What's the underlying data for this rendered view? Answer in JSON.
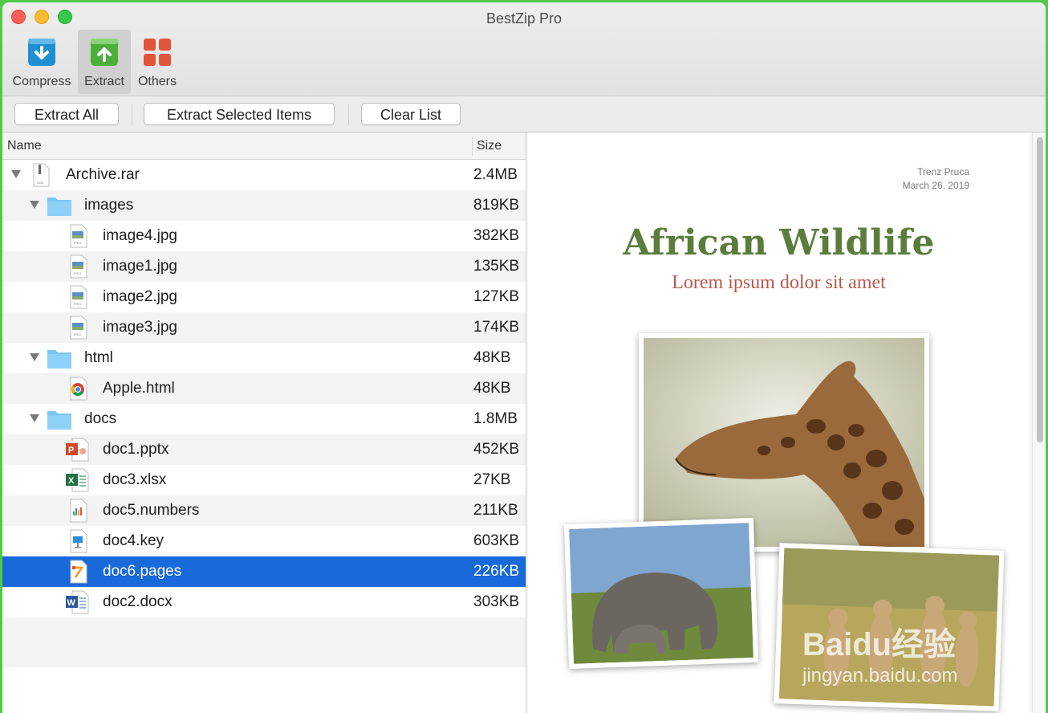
{
  "window": {
    "title": "BestZip Pro"
  },
  "toolbar": {
    "compress_label": "Compress",
    "extract_label": "Extract",
    "others_label": "Others"
  },
  "actions": {
    "extract_all": "Extract All",
    "extract_selected": "Extract Selected Items",
    "clear_list": "Clear List"
  },
  "list": {
    "columns": {
      "name": "Name",
      "size": "Size"
    },
    "rows": [
      {
        "name": "Archive.rar",
        "size": "2.4MB",
        "icon": "archive-icon"
      },
      {
        "name": "images",
        "size": "819KB",
        "icon": "folder-icon"
      },
      {
        "name": "image4.jpg",
        "size": "382KB",
        "icon": "jpeg-icon"
      },
      {
        "name": "image1.jpg",
        "size": "135KB",
        "icon": "jpeg-icon"
      },
      {
        "name": "image2.jpg",
        "size": "127KB",
        "icon": "jpeg-icon"
      },
      {
        "name": "image3.jpg",
        "size": "174KB",
        "icon": "jpeg-icon"
      },
      {
        "name": "html",
        "size": "48KB",
        "icon": "folder-icon"
      },
      {
        "name": "Apple.html",
        "size": "48KB",
        "icon": "chrome-icon"
      },
      {
        "name": "docs",
        "size": "1.8MB",
        "icon": "folder-icon"
      },
      {
        "name": "doc1.pptx",
        "size": "452KB",
        "icon": "powerpoint-icon"
      },
      {
        "name": "doc3.xlsx",
        "size": "27KB",
        "icon": "excel-icon"
      },
      {
        "name": "doc5.numbers",
        "size": "211KB",
        "icon": "numbers-icon"
      },
      {
        "name": "doc4.key",
        "size": "603KB",
        "icon": "keynote-icon"
      },
      {
        "name": "doc6.pages",
        "size": "226KB",
        "icon": "pages-icon"
      },
      {
        "name": "doc2.docx",
        "size": "303KB",
        "icon": "word-icon"
      }
    ],
    "selected": "doc6.pages"
  },
  "preview": {
    "author": "Trenz Pruca",
    "date": "March 26, 2019",
    "title": "African Wildlife",
    "subtitle": "Lorem ipsum dolor sit amet"
  },
  "watermark": {
    "line1": "Baidu经验",
    "line2": "jingyan.baidu.com"
  },
  "colors": {
    "selection": "#1869d9",
    "title_green": "#5b7d3c",
    "subtitle_red": "#b8584a",
    "compress_blue": "#1e8fd0",
    "extract_green": "#4caf3c",
    "others_orange": "#e2553a"
  }
}
